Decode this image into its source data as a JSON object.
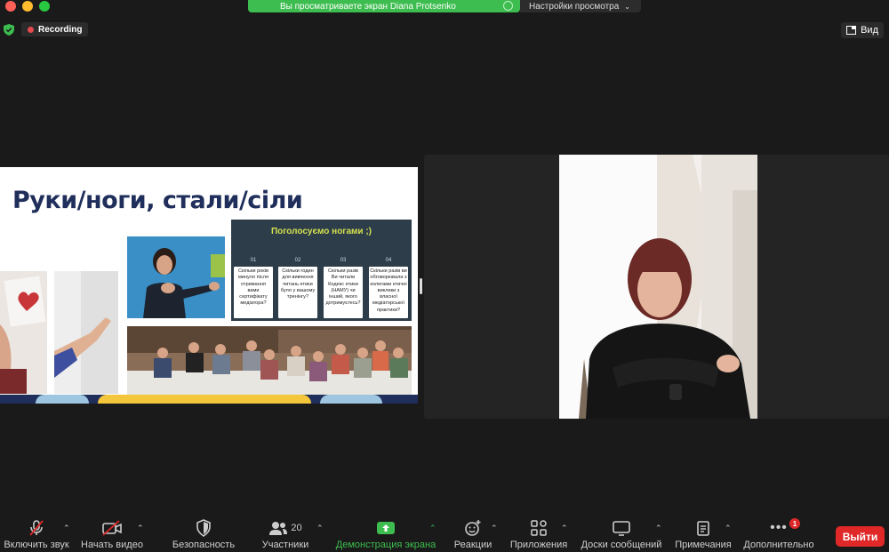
{
  "window": {
    "lights": [
      "#fe5f57",
      "#febc2e",
      "#28c840"
    ]
  },
  "banner": {
    "sharing_text": "Вы просматриваете экран Diana Protsenko",
    "view_settings": "Настройки просмотра"
  },
  "recording": {
    "label": "Recording"
  },
  "view": {
    "label": "Вид"
  },
  "slide": {
    "title": "Руки/ноги, стали/сіли",
    "poll": {
      "title": "Поголосуємо ногами ;)",
      "cards": [
        {
          "num": "01",
          "text": "Скільки років минуло після отримання вами сертифікату медіатора?"
        },
        {
          "num": "02",
          "text": "Скільки годин для вивчення питань етики було у вашому тренінгу?"
        },
        {
          "num": "03",
          "text": "Скільки разів Ви читали Кодекс етики (НАМУ) чи інший, якого дотримуєтесь?"
        },
        {
          "num": "04",
          "text": "Скільки разів ви обговорювали з колегами етичні виклики з власної медіаторської практики?"
        }
      ]
    }
  },
  "toolbar": {
    "items": [
      {
        "label": "Включить звук",
        "icon": "mic-muted-icon"
      },
      {
        "label": "Начать видео",
        "icon": "video-off-icon"
      },
      {
        "label": "Безопасность",
        "icon": "shield-icon"
      },
      {
        "label": "Участники",
        "icon": "participants-icon",
        "count": "20"
      },
      {
        "label": "Демонстрация экрана",
        "icon": "share-screen-icon"
      },
      {
        "label": "Реакции",
        "icon": "reaction-icon"
      },
      {
        "label": "Приложения",
        "icon": "apps-icon"
      },
      {
        "label": "Доски сообщений",
        "icon": "whiteboard-icon"
      },
      {
        "label": "Примечания",
        "icon": "notes-icon"
      },
      {
        "label": "Дополнительно",
        "icon": "more-icon",
        "badge": "1"
      }
    ],
    "exit_label": "Выйти"
  },
  "colors": {
    "accent_green": "#3dbd4f",
    "exit_red": "#e02828",
    "slide_navy": "#1f2e5a"
  }
}
